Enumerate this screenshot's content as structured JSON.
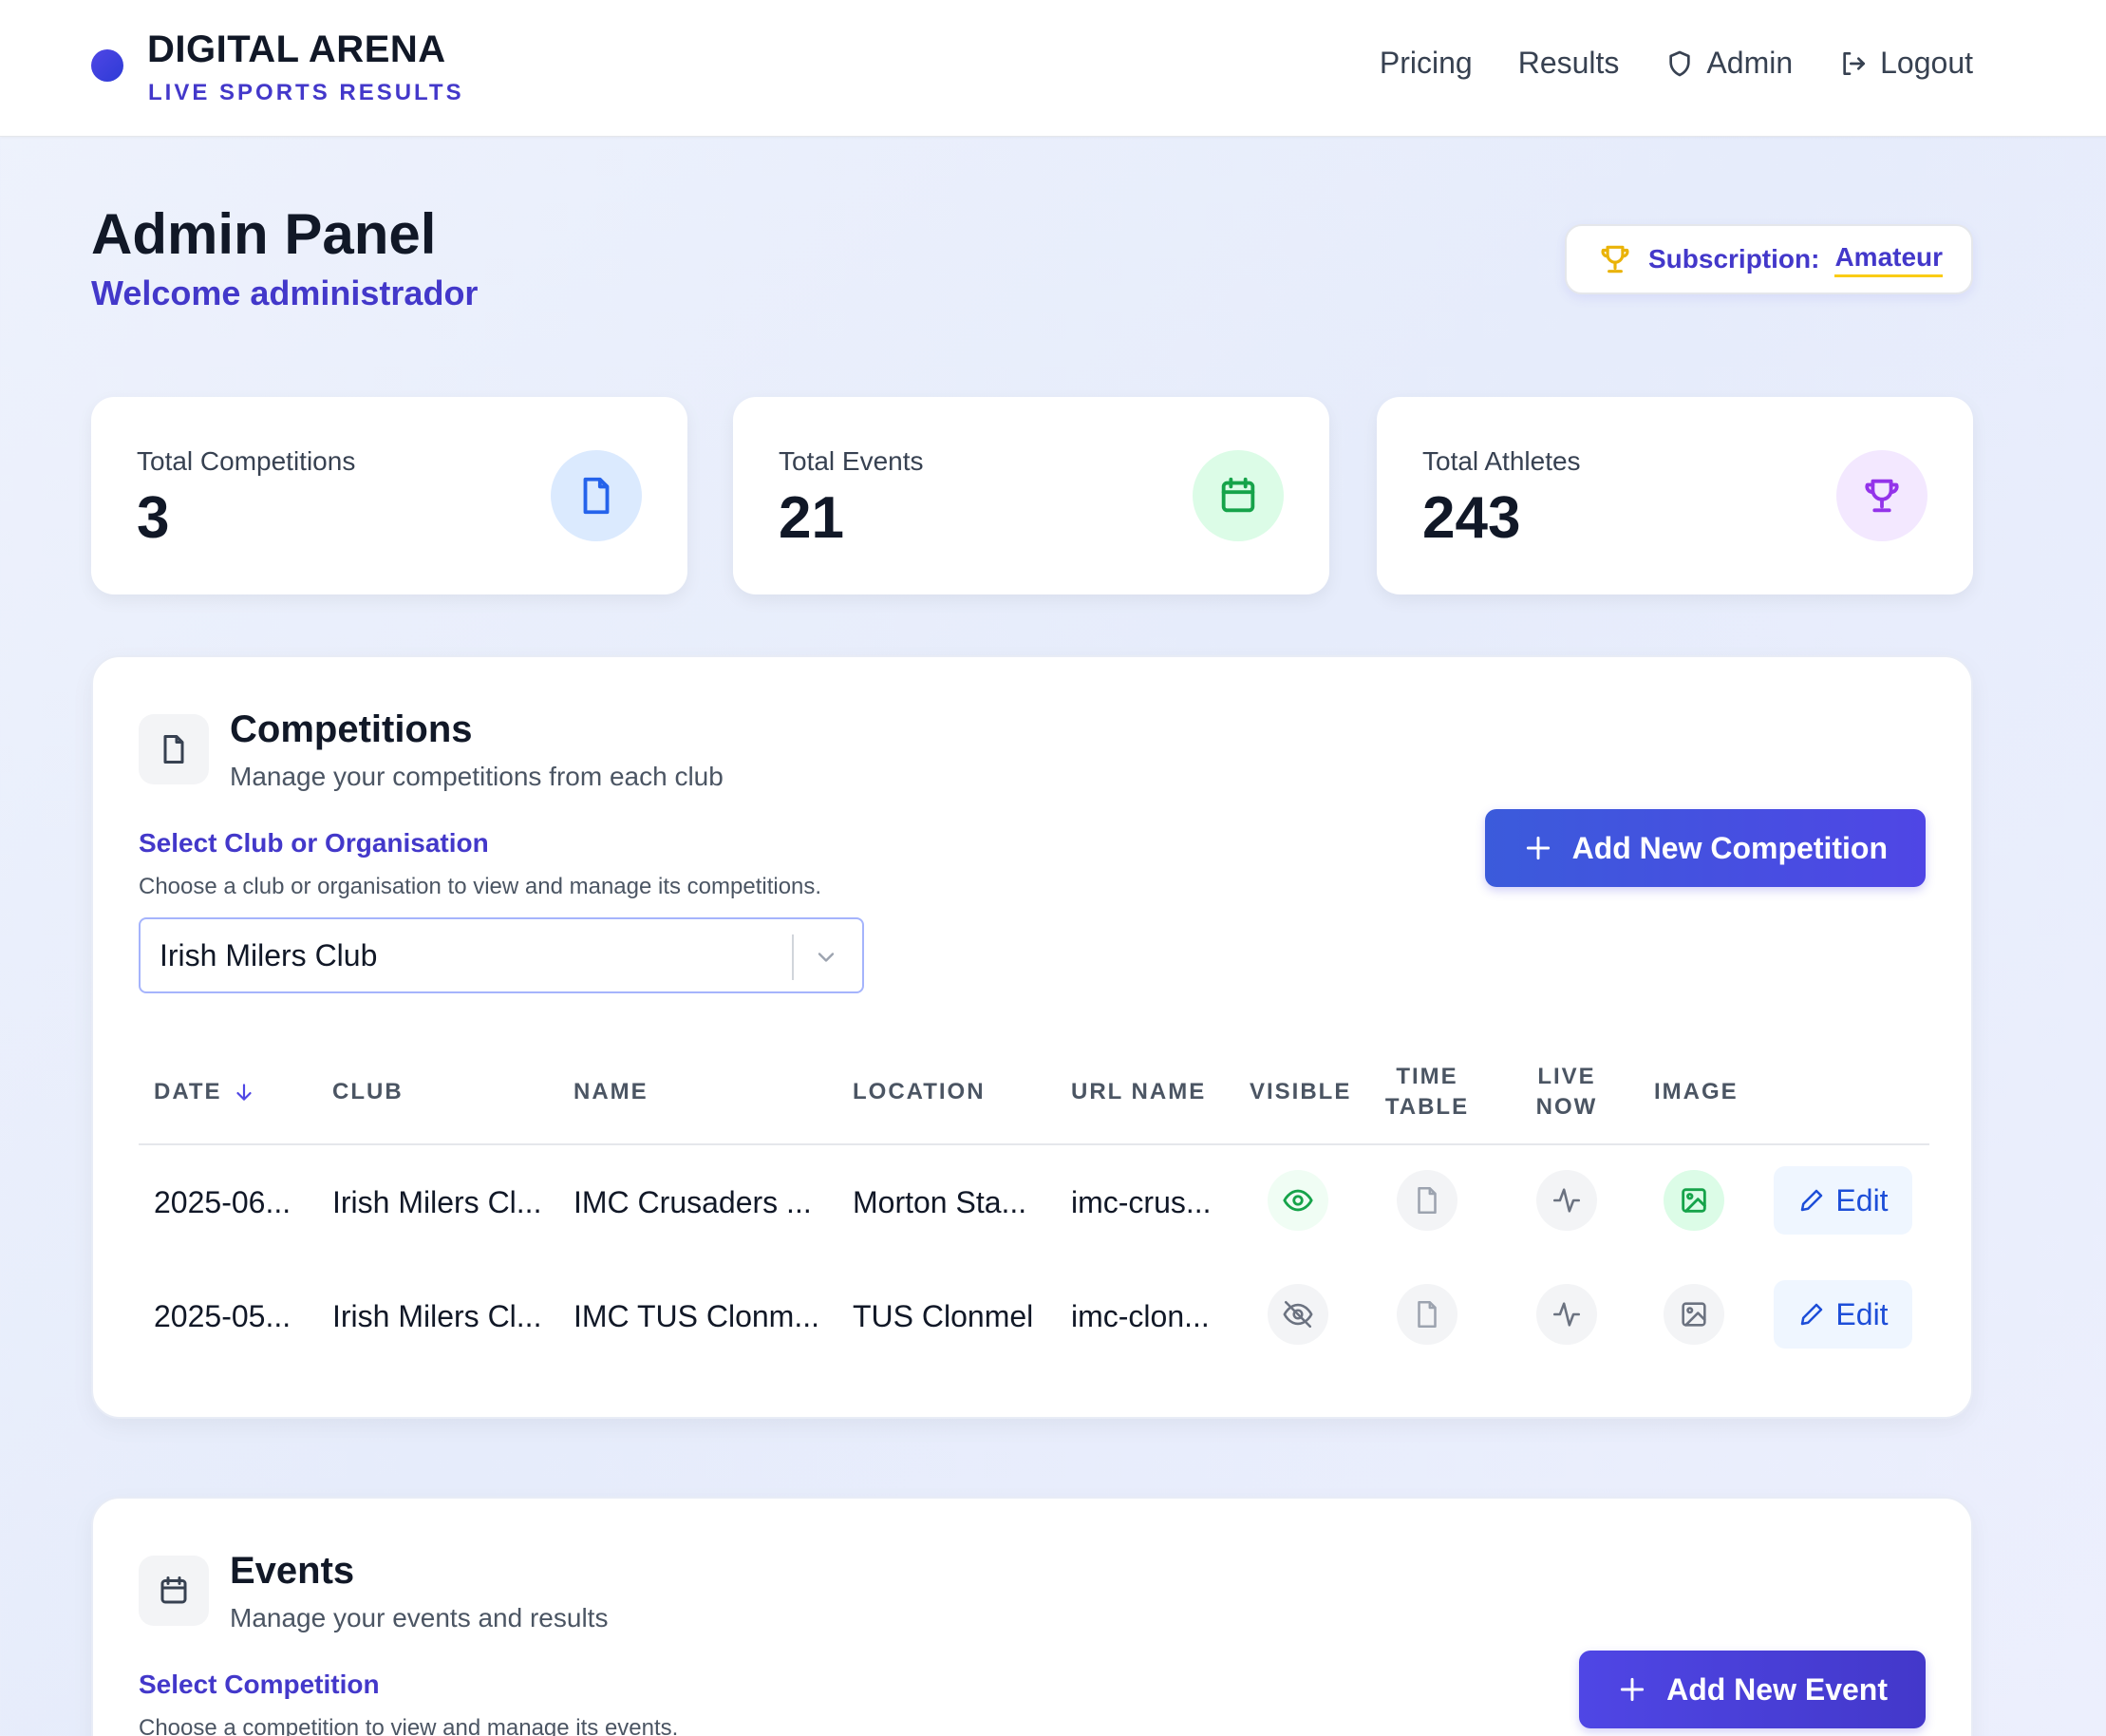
{
  "brand": {
    "title": "DIGITAL ARENA",
    "subtitle": "LIVE SPORTS RESULTS"
  },
  "nav": {
    "pricing": "Pricing",
    "results": "Results",
    "admin": "Admin",
    "logout": "Logout"
  },
  "page": {
    "title": "Admin Panel",
    "welcome": "Welcome administrador"
  },
  "subscription": {
    "label": "Subscription:",
    "plan": "Amateur"
  },
  "stats": [
    {
      "label": "Total Competitions",
      "value": "3"
    },
    {
      "label": "Total Events",
      "value": "21"
    },
    {
      "label": "Total Athletes",
      "value": "243"
    }
  ],
  "competitions": {
    "title": "Competitions",
    "subtitle": "Manage your competitions from each club",
    "select_label": "Select Club or Organisation",
    "select_help": "Choose a club or organisation to view and manage its competitions.",
    "selected_club": "Irish Milers Club",
    "add_button": "Add New Competition",
    "headers": {
      "date": "DATE",
      "club": "CLUB",
      "name": "NAME",
      "location": "LOCATION",
      "url_name": "URL NAME",
      "visible": "VISIBLE",
      "timetable_1": "TIME",
      "timetable_2": "TABLE",
      "live_1": "LIVE",
      "live_2": "NOW",
      "image": "IMAGE"
    },
    "rows": [
      {
        "date": "2025-06...",
        "club": "Irish Milers Cl...",
        "name": "IMC Crusaders ...",
        "location": "Morton Sta...",
        "url": "imc-crus...",
        "visible": true,
        "timetable": false,
        "live": false,
        "image": true,
        "edit": "Edit"
      },
      {
        "date": "2025-05...",
        "club": "Irish Milers Cl...",
        "name": "IMC TUS Clonm...",
        "location": "TUS Clonmel",
        "url": "imc-clon...",
        "visible": false,
        "timetable": false,
        "live": false,
        "image": false,
        "edit": "Edit"
      }
    ]
  },
  "events": {
    "title": "Events",
    "subtitle": "Manage your events and results",
    "select_label": "Select Competition",
    "select_help": "Choose a competition to view and manage its events.",
    "add_button": "Add New Event"
  },
  "colors": {
    "accent": "#4338ca",
    "button": "#4f46e5",
    "success": "#16a34a",
    "muted": "#6b7280"
  }
}
